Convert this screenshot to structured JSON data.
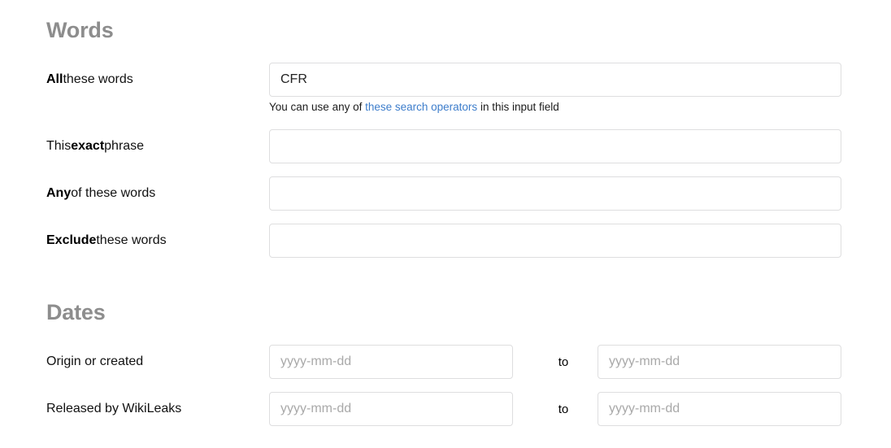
{
  "sections": {
    "words": {
      "heading": "Words",
      "fields": [
        {
          "label_bold": "All",
          "label_rest": " these words",
          "value": "CFR",
          "placeholder": ""
        },
        {
          "label_pre": "This ",
          "label_bold": "exact",
          "label_rest": " phrase",
          "value": "",
          "placeholder": ""
        },
        {
          "label_bold": "Any",
          "label_rest": " of these words",
          "value": "",
          "placeholder": ""
        },
        {
          "label_bold": "Exclude",
          "label_rest": " these words",
          "value": "",
          "placeholder": ""
        }
      ],
      "helper": {
        "prefix": "You can use any of ",
        "link": "these search operators",
        "suffix": " in this input field"
      }
    },
    "dates": {
      "heading": "Dates",
      "separator": "to",
      "rows": [
        {
          "label": "Origin or created",
          "from_value": "",
          "from_placeholder": "yyyy-mm-dd",
          "to_value": "",
          "to_placeholder": "yyyy-mm-dd"
        },
        {
          "label": "Released by WikiLeaks",
          "from_value": "",
          "from_placeholder": "yyyy-mm-dd",
          "to_value": "",
          "to_placeholder": "yyyy-mm-dd"
        }
      ]
    }
  },
  "colors": {
    "heading_gray": "#8d8d8d",
    "link_blue": "#3d7dcb",
    "border_gray": "#dededf",
    "placeholder_gray": "#a9a9a9",
    "text_black": "#111111"
  }
}
